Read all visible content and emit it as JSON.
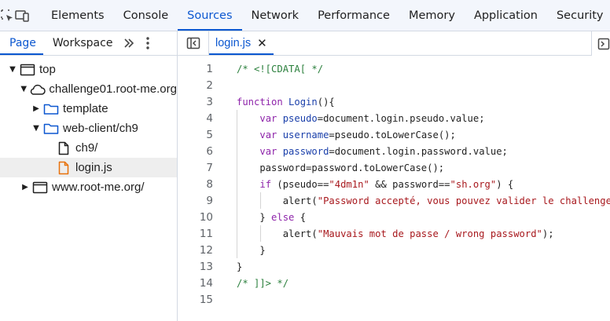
{
  "toolbar": {
    "tabs": [
      "Elements",
      "Console",
      "Sources",
      "Network",
      "Performance",
      "Memory",
      "Application",
      "Security"
    ],
    "active_tab": "Sources"
  },
  "navigator": {
    "tabs": [
      "Page",
      "Workspace"
    ],
    "more": "»",
    "tree": [
      {
        "label": "top",
        "depth": 0,
        "icon": "frame-icon",
        "arrow": "▼"
      },
      {
        "label": "challenge01.root-me.org",
        "depth": 1,
        "icon": "cloud-icon",
        "arrow": "▼"
      },
      {
        "label": "template",
        "depth": 2,
        "icon": "folder-icon",
        "arrow": "▶"
      },
      {
        "label": "web-client/ch9",
        "depth": 2,
        "icon": "folder-icon",
        "arrow": "▼"
      },
      {
        "label": "ch9/",
        "depth": 3,
        "icon": "document-icon",
        "arrow": ""
      },
      {
        "label": "login.js",
        "depth": 3,
        "icon": "js-file-icon",
        "arrow": "",
        "selected": true
      },
      {
        "label": "www.root-me.org/",
        "depth": 1,
        "icon": "frame-icon",
        "arrow": "▶"
      }
    ]
  },
  "editor": {
    "file_tab": "login.js",
    "close_glyph": "✕",
    "lines": [
      {
        "n": "1",
        "tokens": [
          [
            "c",
            "/* <![CDATA[ */"
          ]
        ]
      },
      {
        "n": "2",
        "tokens": []
      },
      {
        "n": "3",
        "tokens": [
          [
            "k",
            "function "
          ],
          [
            "v",
            "Login"
          ],
          [
            "p",
            "(){"
          ]
        ]
      },
      {
        "n": "4",
        "tokens": [
          [
            "p",
            "    "
          ],
          [
            "k",
            "var "
          ],
          [
            "v",
            "pseudo"
          ],
          [
            "p",
            "=document.login.pseudo.value;"
          ]
        ]
      },
      {
        "n": "5",
        "tokens": [
          [
            "p",
            "    "
          ],
          [
            "k",
            "var "
          ],
          [
            "v",
            "username"
          ],
          [
            "p",
            "=pseudo.toLowerCase();"
          ]
        ]
      },
      {
        "n": "6",
        "tokens": [
          [
            "p",
            "    "
          ],
          [
            "k",
            "var "
          ],
          [
            "v",
            "password"
          ],
          [
            "p",
            "=document.login.password.value;"
          ]
        ]
      },
      {
        "n": "7",
        "tokens": [
          [
            "p",
            "    password=password.toLowerCase();"
          ]
        ]
      },
      {
        "n": "8",
        "tokens": [
          [
            "p",
            "    "
          ],
          [
            "k",
            "if "
          ],
          [
            "p",
            "(pseudo=="
          ],
          [
            "s",
            "\"4dm1n\""
          ],
          [
            "p",
            " && password=="
          ],
          [
            "s",
            "\"sh.org\""
          ],
          [
            "p",
            ") {"
          ]
        ]
      },
      {
        "n": "9",
        "tokens": [
          [
            "p",
            "        alert("
          ],
          [
            "s",
            "\"Password accepté, vous pouvez valider le challenge avec ce mot de passe.\\nYou an validate the challenge using this password.\""
          ],
          [
            "p",
            ");"
          ]
        ]
      },
      {
        "n": "10",
        "tokens": [
          [
            "p",
            "    } "
          ],
          [
            "k",
            "else "
          ],
          [
            "p",
            "{"
          ]
        ]
      },
      {
        "n": "11",
        "tokens": [
          [
            "p",
            "        alert("
          ],
          [
            "s",
            "\"Mauvais mot de passe / wrong password\""
          ],
          [
            "p",
            ");"
          ]
        ]
      },
      {
        "n": "12",
        "tokens": [
          [
            "p",
            "    }"
          ]
        ]
      },
      {
        "n": "13",
        "tokens": [
          [
            "p",
            "}"
          ]
        ]
      },
      {
        "n": "14",
        "tokens": [
          [
            "c",
            "/* ]]> */"
          ]
        ]
      },
      {
        "n": "15",
        "tokens": []
      }
    ]
  },
  "colors": {
    "accent": "#0b57d0",
    "keyword": "#8e24aa",
    "string": "#a8191e",
    "comment": "#2a7f3c",
    "variable": "#1a3faa",
    "js_file": "#e8710a"
  }
}
